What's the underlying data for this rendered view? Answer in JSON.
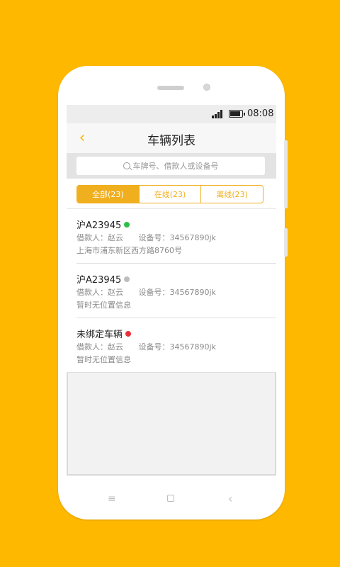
{
  "status_bar": {
    "time": "08:08",
    "battery_level": 0.8,
    "signal_bars": 4
  },
  "header": {
    "title": "车辆列表",
    "back_icon": "chevron-left-icon"
  },
  "search": {
    "placeholder": "车牌号、借款人或设备号",
    "icon": "search-icon"
  },
  "tabs": [
    {
      "label": "全部(23)",
      "active": true
    },
    {
      "label": "在线(23)",
      "active": false
    },
    {
      "label": "离线(23)",
      "active": false
    }
  ],
  "vehicles": [
    {
      "plate": "沪A23945",
      "status_color": "#2DBE4A",
      "borrower": "借款人：赵云",
      "device": "设备号：34567890jk",
      "location": "上海市浦东新区西方路8760号"
    },
    {
      "plate": "沪A23945",
      "status_color": "#BDBDBD",
      "borrower": "借款人：赵云",
      "device": "设备号：34567890jk",
      "location": "暂时无位置信息"
    },
    {
      "plate": "未绑定车辆",
      "status_color": "#E8303D",
      "borrower": "借款人：赵云",
      "device": "设备号：34567890jk",
      "location": "暂时无位置信息"
    }
  ],
  "system_nav": {
    "menu_icon": "menu-icon",
    "home_icon": "home-icon",
    "back_icon": "back-arrow-icon"
  },
  "colors": {
    "background": "#FFB800",
    "accent": "#F0AF1E"
  }
}
